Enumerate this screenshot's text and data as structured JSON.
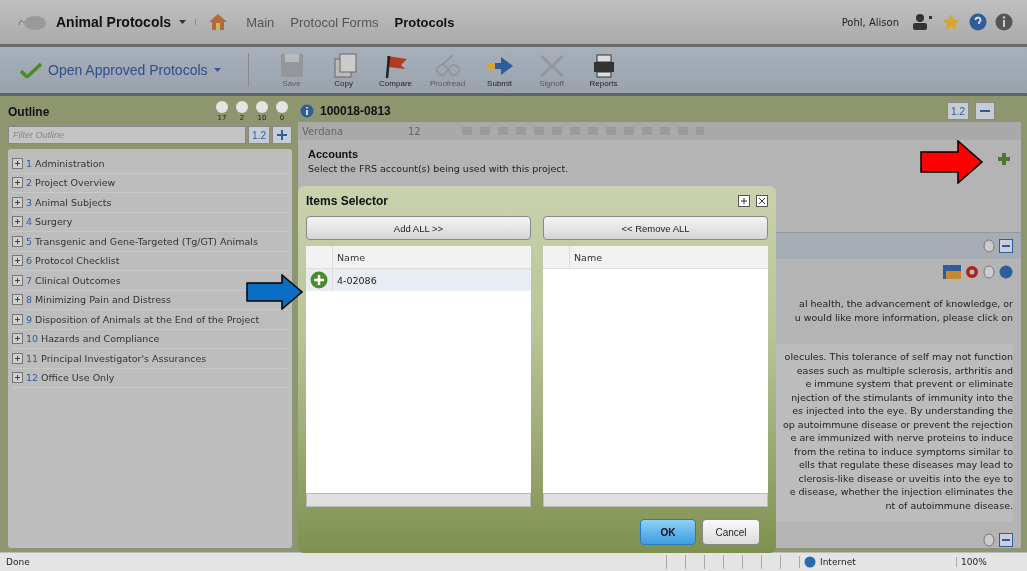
{
  "app": {
    "title": "Animal Protocols",
    "nav": [
      {
        "label": "Main",
        "selected": false
      },
      {
        "label": "Protocol Forms",
        "selected": false
      },
      {
        "label": "Protocols",
        "selected": true
      }
    ],
    "user": "Pohl, Alison"
  },
  "toolbar": {
    "menu": "Open Approved Protocols",
    "buttons": [
      {
        "label": "Save",
        "disabled": true
      },
      {
        "label": "Copy",
        "disabled": false
      },
      {
        "label": "Compare",
        "disabled": false
      },
      {
        "label": "Proofread",
        "disabled": true
      },
      {
        "label": "Submit",
        "disabled": false
      },
      {
        "label": "Signoff",
        "disabled": true
      },
      {
        "label": "Reports",
        "disabled": false
      }
    ]
  },
  "outline": {
    "title": "Outline",
    "counters": [
      "17",
      "2",
      "10",
      "0"
    ],
    "filter_placeholder": "Filter Outline",
    "version": "1.2",
    "items": [
      {
        "number": "1",
        "label": "Administration",
        "expanded": false
      },
      {
        "number": "2",
        "label": "Project Overview",
        "expanded": false
      },
      {
        "number": "3",
        "label": "Animal Subjects",
        "expanded": false
      },
      {
        "number": "4",
        "label": "Surgery",
        "expanded": false
      },
      {
        "number": "5",
        "label": "Transgenic and Gene-Targeted (Tg/GT) Animals",
        "expanded": false
      },
      {
        "number": "6",
        "label": "Protocol Checklist",
        "expanded": false
      },
      {
        "number": "7",
        "label": "Clinical Outcomes",
        "expanded": false
      },
      {
        "number": "8",
        "label": "Minimizing Pain and Distress",
        "expanded": false
      },
      {
        "number": "9",
        "label": "Disposition of Animals at the End of the Project",
        "expanded": false
      },
      {
        "number": "10",
        "label": "Hazards and Compliance",
        "expanded": false
      },
      {
        "number": "11",
        "label": "Principal Investigator's Assurances",
        "expanded": false
      },
      {
        "number": "12",
        "label": "Office Use Only",
        "expanded": false
      }
    ]
  },
  "document": {
    "id": "100018-0813",
    "version": "1.2",
    "editor": {
      "font": "Verdana",
      "size": "12"
    },
    "section": {
      "title": "Accounts",
      "description": "Select the FRS account(s) being used with this project."
    },
    "intro": [
      "al health, the advancement of knowledge, or",
      "u would like more information, please click on"
    ],
    "paragraph": [
      "olecules. This tolerance of self may not function",
      "eases such as multiple sclerosis, arthritis and",
      "e immune system that prevent or eliminate",
      "njection of the stimulants of immunity into the",
      "es injected into the eye. By understanding the",
      "op autoimmune disease or prevent the rejection",
      "e are immunized with nerve proteins to induce",
      "from the retina to induce symptoms similar to",
      "ells that regulate these diseases may lead to",
      "clerosis-like disease or uveitis into the eye to",
      "e disease, whether the injection eliminates the",
      "nt of autoimmune disease."
    ]
  },
  "dialog": {
    "title": "Items Selector",
    "add_all": "Add ALL >>",
    "remove_all": "<< Remove ALL",
    "available": {
      "column": "Name",
      "rows": [
        "4-02086"
      ]
    },
    "chosen": {
      "column": "Name"
    },
    "ok": "OK",
    "cancel": "Cancel"
  },
  "status_bar": {
    "status": "Done",
    "zone": "Internet",
    "zoom": "100%"
  }
}
